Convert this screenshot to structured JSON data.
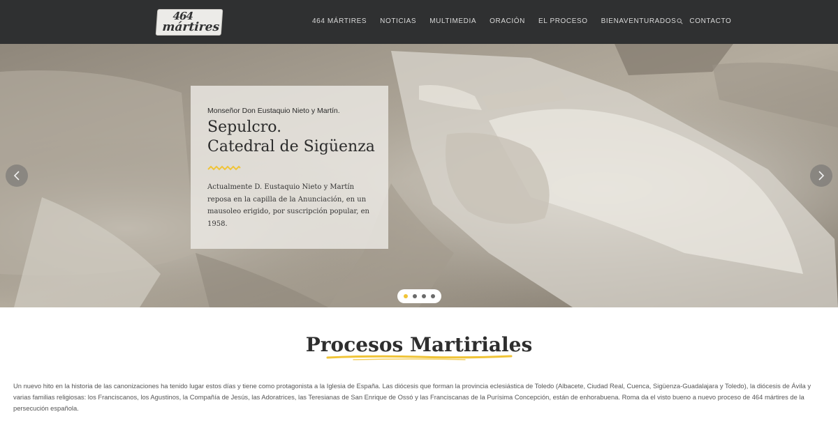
{
  "header": {
    "logo": {
      "number": "464",
      "word": "mártires"
    },
    "nav": [
      {
        "label": "464 MÁRTIRES"
      },
      {
        "label": "NOTICIAS"
      },
      {
        "label": "MULTIMEDIA"
      },
      {
        "label": "ORACIÓN"
      },
      {
        "label": "EL PROCESO"
      },
      {
        "label": "BIENAVENTURADOS"
      },
      {
        "label": "CONTACTO"
      }
    ],
    "search_icon": "search-icon"
  },
  "hero": {
    "kicker": "Monseñor Don Eustaquio Nieto y Martín.",
    "title_line1": "Sepulcro.",
    "title_line2": "Catedral de Sigüenza",
    "body": "Actualmente D. Eustaquio Nieto y Martín reposa en la capilla de la Anunciación, en un mausoleo erigido, por suscripción popular, en 1958.",
    "prev_icon": "chevron-left-icon",
    "next_icon": "chevron-right-icon",
    "slide_count": 4,
    "active_slide": 1
  },
  "section": {
    "title": "Procesos Martiriales",
    "intro": "Un nuevo hito en la historia de las canonizaciones ha tenido lugar estos días y tiene como protagonista a la Iglesia de España. Las diócesis que forman la provincia eclesiástica de Toledo (Albacete, Ciudad Real, Cuenca, Sigüenza-Guadalajara y Toledo), la diócesis de Ávila y varias familias religiosas: los Franciscanos, los Agustinos, la Compañía de Jesús, las Adoratrices, las Teresianas de San Enrique de Ossó y las Franciscanas de la Purísima Concepción, están de enhorabuena. Roma da el visto bueno a nuevo proceso de 464 mártires de la persecución española."
  },
  "colors": {
    "header_bg": "#2f3031",
    "accent_yellow": "#f0c437",
    "nav_text": "#d9d9d9"
  }
}
